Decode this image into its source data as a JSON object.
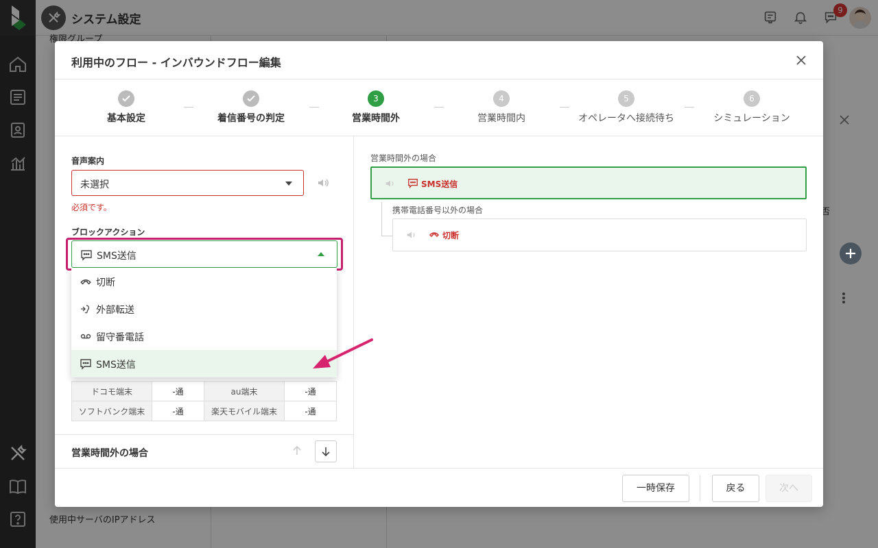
{
  "header": {
    "app_title": "システム設定",
    "notification_count": "9"
  },
  "bg_sidebar": {
    "items": [
      "権限グループ",
      "使用中サーバのIPアドレス"
    ]
  },
  "bg_main": {
    "fragment": "拒否"
  },
  "modal": {
    "title": "利用中のフロー - インバウンドフロー編集",
    "steps": [
      {
        "num": "",
        "label": "基本設定",
        "state": "done"
      },
      {
        "num": "",
        "label": "着信番号の判定",
        "state": "done"
      },
      {
        "num": "3",
        "label": "営業時間外",
        "state": "active"
      },
      {
        "num": "4",
        "label": "営業時間内",
        "state": "todo"
      },
      {
        "num": "5",
        "label": "オペレータへ接続待ち",
        "state": "todo"
      },
      {
        "num": "6",
        "label": "シミュレーション",
        "state": "todo"
      }
    ],
    "voice": {
      "label": "音声案内",
      "value": "未選択",
      "error": "必須です。"
    },
    "block_action": {
      "label": "ブロックアクション",
      "value": "SMS送信",
      "options": [
        {
          "label": "切断",
          "icon": "hangup-icon"
        },
        {
          "label": "外部転送",
          "icon": "transfer-icon"
        },
        {
          "label": "留守番電話",
          "icon": "voicemail-icon"
        },
        {
          "label": "SMS送信",
          "icon": "sms-icon",
          "selected": true
        }
      ]
    },
    "carrier_table": [
      [
        {
          "h": "ドコモ端末"
        },
        {
          "v": "-通"
        },
        {
          "h": "au端末"
        },
        {
          "v": "-通"
        }
      ],
      [
        {
          "h": "ソフトバンク端末"
        },
        {
          "v": "-通"
        },
        {
          "h": "楽天モバイル端末"
        },
        {
          "v": "-通"
        }
      ]
    ],
    "section_title": "営業時間外の場合",
    "flow": {
      "outside_hours_label": "営業時間外の場合",
      "outside_hours_action": "SMS送信",
      "non_mobile_label": "携帯電話番号以外の場合",
      "non_mobile_action": "切断"
    },
    "footer": {
      "save_temp": "一時保存",
      "back": "戻る",
      "next": "次へ"
    }
  },
  "colors": {
    "accent_green": "#2f9e44",
    "error_red": "#c9302c",
    "highlight_pink": "#c51e6e"
  }
}
